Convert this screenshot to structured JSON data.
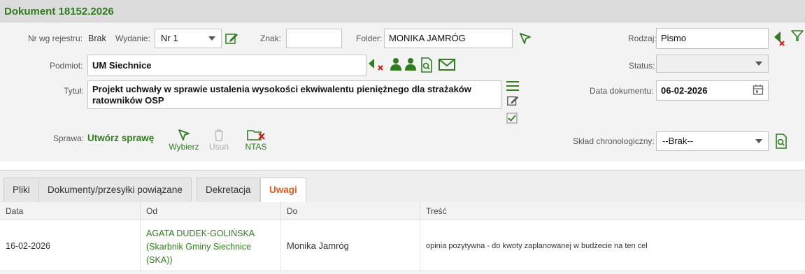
{
  "window": {
    "title": "Dokument 18152.2026"
  },
  "form": {
    "nr_label": "Nr wg rejestru:",
    "nr_value": "Brak",
    "wydanie_label": "Wydanie:",
    "wydanie_value": "Nr 1",
    "znak_label": "Znak:",
    "znak_value": "",
    "folder_label": "Folder:",
    "folder_value": "MONIKA JAMRÓG",
    "rodzaj_label": "Rodzaj:",
    "rodzaj_value": "Pismo",
    "podmiot_label": "Podmiot:",
    "podmiot_value": "UM Siechnice",
    "status_label": "Status:",
    "status_value": "",
    "tytul_label": "Tytuł:",
    "tytul_value": "Projekt uchwały w sprawie ustalenia wysokości ekwiwalentu pieniężnego dla strażaków ratowników OSP",
    "data_label": "Data dokumentu:",
    "data_value": "06-02-2026",
    "sprawa_label": "Sprawa:",
    "sprawa_link": "Utwórz sprawę",
    "wybierz": "Wybierz",
    "usun": "Usuń",
    "ntas": "NTAS",
    "sklad_label": "Skład chronologiczny:",
    "sklad_value": "--Brak--"
  },
  "tabs": [
    {
      "label": "Pliki",
      "active": false
    },
    {
      "label": "Dokumenty/przesyłki powiązane",
      "active": false
    },
    {
      "label": "Dekretacja",
      "active": false
    },
    {
      "label": "Uwagi",
      "active": true
    }
  ],
  "table": {
    "columns": [
      "Data",
      "Od",
      "Do",
      "Treść"
    ],
    "rows": [
      {
        "data": "16-02-2026",
        "od_lines": [
          "AGATA DUDEK-GOLIŃSKA",
          "(Skarbnik Gminy Siechnice",
          "(SKA))"
        ],
        "do": "Monika Jamróg",
        "tresc": "opinia pozytywna - do kwoty zaplanowanej w budżecie na ten cel"
      }
    ]
  },
  "colors": {
    "accent_green": "#2f7d1f",
    "active_tab": "#e85a1e",
    "delete_red": "#d11"
  },
  "icons": [
    "edit-icon",
    "pointer-icon",
    "filter-icon",
    "back-arrow-delete-icon",
    "person-icon",
    "document-search-icon",
    "envelope-icon",
    "list-icon",
    "checkmark-icon",
    "calendar-icon",
    "trash-icon",
    "folder-delete-icon"
  ]
}
